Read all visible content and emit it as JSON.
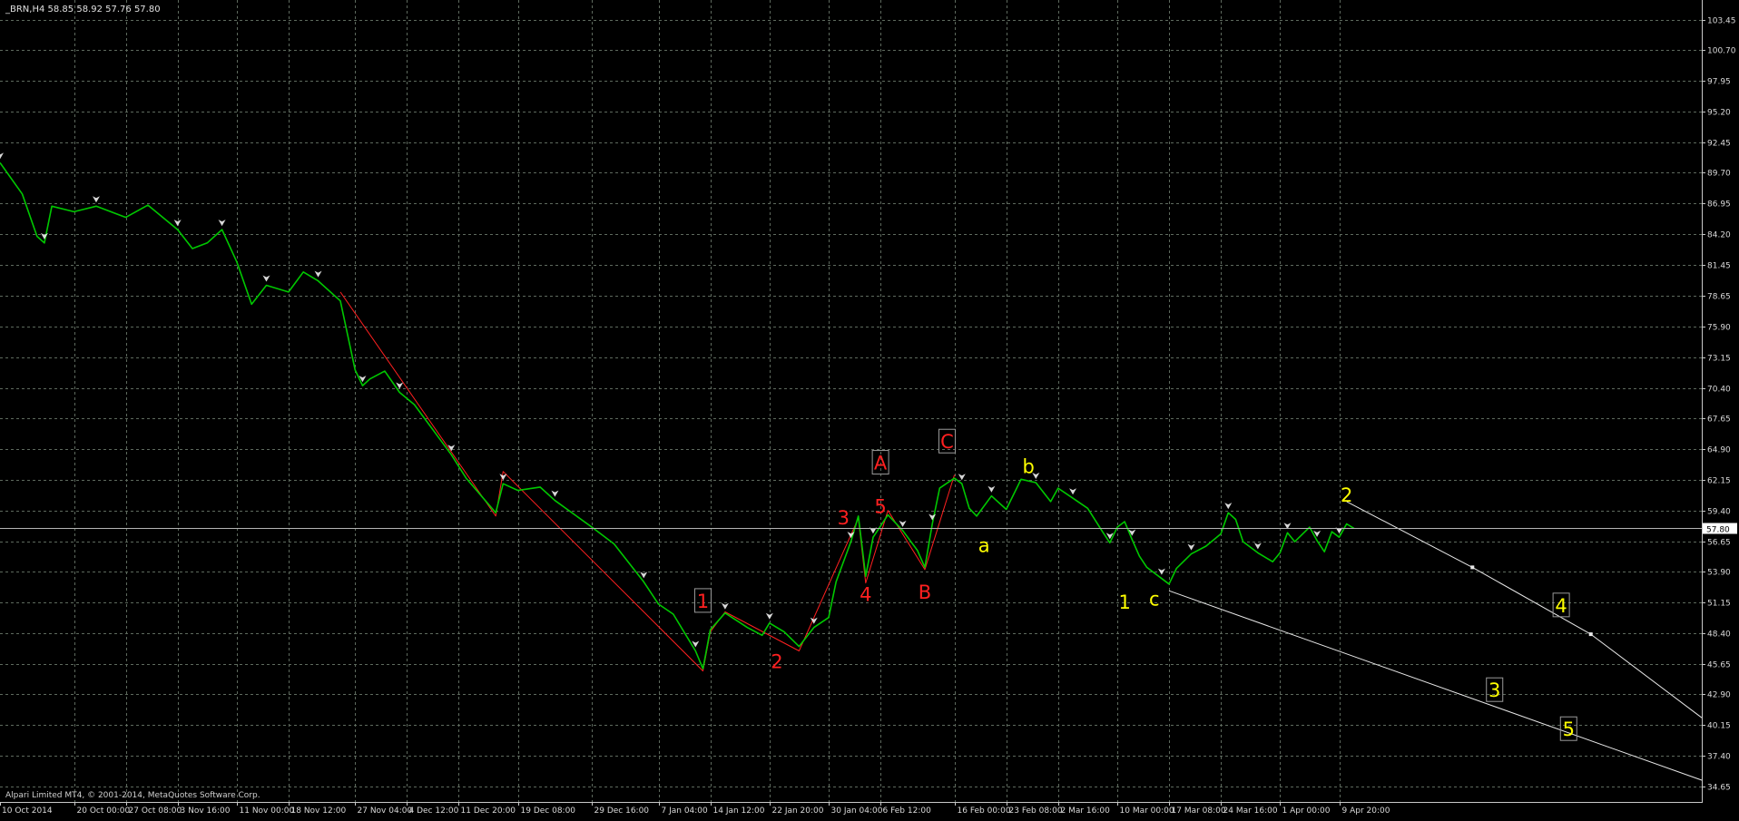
{
  "header": {
    "symbol_info": "_BRN,H4  58.85 58.92 57.76 57.80"
  },
  "footer": {
    "copyright": "Alpari Limited MT4, © 2001-2014, MetaQuotes Software Corp."
  },
  "current_price": {
    "label": "57.80",
    "value": 57.8
  },
  "colors": {
    "background": "#000000",
    "grid": "#5e6a5e",
    "price_line": "#00c800",
    "wave_red": "#ff2020",
    "wave_yellow": "#ffff00",
    "projection": "#e8e8e8",
    "axis_text": "#d8d8d8"
  },
  "chart_data": {
    "type": "line",
    "title": "",
    "symbol": "_BRN",
    "timeframe": "H4",
    "ohlc_header": {
      "open": 58.85,
      "high": 58.92,
      "low": 57.76,
      "close": 57.8
    },
    "ylim": [
      33.25,
      105.2
    ],
    "y_ticks": [
      103.45,
      100.7,
      97.95,
      95.2,
      92.45,
      89.7,
      86.95,
      84.2,
      81.45,
      78.65,
      75.9,
      73.15,
      70.4,
      67.65,
      64.9,
      62.15,
      59.4,
      56.65,
      53.9,
      51.15,
      48.4,
      45.65,
      42.9,
      40.15,
      37.4,
      34.65
    ],
    "y_tick_labels": [
      "103.45",
      "100.70",
      "97.95",
      "95.20",
      "92.45",
      "89.70",
      "86.95",
      "84.20",
      "81.45",
      "78.65",
      "75.90",
      "73.15",
      "70.40",
      "67.65",
      "64.90",
      "62.15",
      "59.40",
      "56.65",
      "53.90",
      "51.15",
      "48.40",
      "45.65",
      "42.90",
      "40.15",
      "37.40",
      "34.65"
    ],
    "x_range": [
      "2014-10-10",
      "2015-05-28"
    ],
    "x_ticks": [
      {
        "date": "2014-10-10",
        "label": "10 Oct 2014"
      },
      {
        "date": "2014-10-20",
        "label": "20 Oct 00:00"
      },
      {
        "date": "2014-10-27",
        "label": "27 Oct 08:00"
      },
      {
        "date": "2014-11-03",
        "label": "3 Nov 16:00"
      },
      {
        "date": "2014-11-11",
        "label": "11 Nov 00:00"
      },
      {
        "date": "2014-11-18",
        "label": "18 Nov 12:00"
      },
      {
        "date": "2014-11-27",
        "label": "27 Nov 04:00"
      },
      {
        "date": "2014-12-04",
        "label": "4 Dec 12:00"
      },
      {
        "date": "2014-12-11",
        "label": "11 Dec 20:00"
      },
      {
        "date": "2014-12-19",
        "label": "19 Dec 08:00"
      },
      {
        "date": "2014-12-29",
        "label": "29 Dec 16:00"
      },
      {
        "date": "2015-01-07",
        "label": "7 Jan 04:00"
      },
      {
        "date": "2015-01-14",
        "label": "14 Jan 12:00"
      },
      {
        "date": "2015-01-22",
        "label": "22 Jan 20:00"
      },
      {
        "date": "2015-01-30",
        "label": "30 Jan 04:00"
      },
      {
        "date": "2015-02-06",
        "label": "6 Feb 12:00"
      },
      {
        "date": "2015-02-16",
        "label": "16 Feb 00:00"
      },
      {
        "date": "2015-02-23",
        "label": "23 Feb 08:00"
      },
      {
        "date": "2015-03-02",
        "label": "2 Mar 16:00"
      },
      {
        "date": "2015-03-10",
        "label": "10 Mar 00:00"
      },
      {
        "date": "2015-03-17",
        "label": "17 Mar 08:00"
      },
      {
        "date": "2015-03-24",
        "label": "24 Mar 16:00"
      },
      {
        "date": "2015-04-01",
        "label": "1 Apr 00:00"
      },
      {
        "date": "2015-04-09",
        "label": "9 Apr 20:00"
      }
    ],
    "grid": true,
    "series": [
      {
        "role": "price",
        "values": [
          {
            "x": "2014-10-10",
            "y": 90.6
          },
          {
            "x": "2014-10-13",
            "y": 87.8
          },
          {
            "x": "2014-10-15",
            "y": 84.0
          },
          {
            "x": "2014-10-16",
            "y": 83.4
          },
          {
            "x": "2014-10-17",
            "y": 86.7
          },
          {
            "x": "2014-10-20",
            "y": 86.2
          },
          {
            "x": "2014-10-23",
            "y": 86.7
          },
          {
            "x": "2014-10-27",
            "y": 85.7
          },
          {
            "x": "2014-10-30",
            "y": 86.8
          },
          {
            "x": "2014-11-03",
            "y": 84.6
          },
          {
            "x": "2014-11-05",
            "y": 82.9
          },
          {
            "x": "2014-11-07",
            "y": 83.4
          },
          {
            "x": "2014-11-09",
            "y": 84.6
          },
          {
            "x": "2014-11-11",
            "y": 81.7
          },
          {
            "x": "2014-11-13",
            "y": 77.9
          },
          {
            "x": "2014-11-15",
            "y": 79.6
          },
          {
            "x": "2014-11-18",
            "y": 79.0
          },
          {
            "x": "2014-11-20",
            "y": 80.8
          },
          {
            "x": "2014-11-22",
            "y": 80.0
          },
          {
            "x": "2014-11-25",
            "y": 78.2
          },
          {
            "x": "2014-11-27",
            "y": 72.0
          },
          {
            "x": "2014-11-28",
            "y": 70.6
          },
          {
            "x": "2014-11-29",
            "y": 71.2
          },
          {
            "x": "2014-12-01",
            "y": 71.9
          },
          {
            "x": "2014-12-03",
            "y": 70.0
          },
          {
            "x": "2014-12-05",
            "y": 68.9
          },
          {
            "x": "2014-12-08",
            "y": 66.2
          },
          {
            "x": "2014-12-10",
            "y": 64.4
          },
          {
            "x": "2014-12-12",
            "y": 62.3
          },
          {
            "x": "2014-12-16",
            "y": 59.2
          },
          {
            "x": "2014-12-17",
            "y": 61.8
          },
          {
            "x": "2014-12-19",
            "y": 61.2
          },
          {
            "x": "2014-12-22",
            "y": 61.5
          },
          {
            "x": "2014-12-24",
            "y": 60.3
          },
          {
            "x": "2014-12-29",
            "y": 57.9
          },
          {
            "x": "2015-01-01",
            "y": 56.4
          },
          {
            "x": "2015-01-05",
            "y": 53.0
          },
          {
            "x": "2015-01-07",
            "y": 51.0
          },
          {
            "x": "2015-01-09",
            "y": 50.1
          },
          {
            "x": "2015-01-12",
            "y": 46.8
          },
          {
            "x": "2015-01-13",
            "y": 45.2
          },
          {
            "x": "2015-01-14",
            "y": 48.7
          },
          {
            "x": "2015-01-16",
            "y": 50.2
          },
          {
            "x": "2015-01-19",
            "y": 48.9
          },
          {
            "x": "2015-01-21",
            "y": 48.2
          },
          {
            "x": "2015-01-22",
            "y": 49.3
          },
          {
            "x": "2015-01-24",
            "y": 48.5
          },
          {
            "x": "2015-01-26",
            "y": 47.2
          },
          {
            "x": "2015-01-28",
            "y": 48.9
          },
          {
            "x": "2015-01-30",
            "y": 49.8
          },
          {
            "x": "2015-01-31",
            "y": 53.0
          },
          {
            "x": "2015-02-02",
            "y": 56.6
          },
          {
            "x": "2015-02-03",
            "y": 58.9
          },
          {
            "x": "2015-02-04",
            "y": 53.5
          },
          {
            "x": "2015-02-05",
            "y": 57.0
          },
          {
            "x": "2015-02-06",
            "y": 58.0
          },
          {
            "x": "2015-02-07",
            "y": 59.0
          },
          {
            "x": "2015-02-09",
            "y": 57.6
          },
          {
            "x": "2015-02-11",
            "y": 55.8
          },
          {
            "x": "2015-02-12",
            "y": 54.3
          },
          {
            "x": "2015-02-13",
            "y": 58.2
          },
          {
            "x": "2015-02-14",
            "y": 61.4
          },
          {
            "x": "2015-02-16",
            "y": 62.3
          },
          {
            "x": "2015-02-17",
            "y": 61.8
          },
          {
            "x": "2015-02-18",
            "y": 59.6
          },
          {
            "x": "2015-02-19",
            "y": 58.9
          },
          {
            "x": "2015-02-21",
            "y": 60.7
          },
          {
            "x": "2015-02-23",
            "y": 59.5
          },
          {
            "x": "2015-02-25",
            "y": 62.2
          },
          {
            "x": "2015-02-27",
            "y": 61.9
          },
          {
            "x": "2015-03-01",
            "y": 60.2
          },
          {
            "x": "2015-03-02",
            "y": 61.4
          },
          {
            "x": "2015-03-04",
            "y": 60.5
          },
          {
            "x": "2015-03-06",
            "y": 59.6
          },
          {
            "x": "2015-03-08",
            "y": 57.5
          },
          {
            "x": "2015-03-09",
            "y": 56.5
          },
          {
            "x": "2015-03-10",
            "y": 57.9
          },
          {
            "x": "2015-03-11",
            "y": 58.4
          },
          {
            "x": "2015-03-12",
            "y": 56.8
          },
          {
            "x": "2015-03-13",
            "y": 55.3
          },
          {
            "x": "2015-03-14",
            "y": 54.3
          },
          {
            "x": "2015-03-16",
            "y": 53.3
          },
          {
            "x": "2015-03-17",
            "y": 52.8
          },
          {
            "x": "2015-03-18",
            "y": 54.2
          },
          {
            "x": "2015-03-20",
            "y": 55.5
          },
          {
            "x": "2015-03-22",
            "y": 56.2
          },
          {
            "x": "2015-03-24",
            "y": 57.3
          },
          {
            "x": "2015-03-25",
            "y": 59.2
          },
          {
            "x": "2015-03-26",
            "y": 58.6
          },
          {
            "x": "2015-03-27",
            "y": 56.6
          },
          {
            "x": "2015-03-29",
            "y": 55.6
          },
          {
            "x": "2015-03-31",
            "y": 54.8
          },
          {
            "x": "2015-04-01",
            "y": 55.6
          },
          {
            "x": "2015-04-02",
            "y": 57.4
          },
          {
            "x": "2015-04-03",
            "y": 56.6
          },
          {
            "x": "2015-04-05",
            "y": 57.9
          },
          {
            "x": "2015-04-06",
            "y": 56.7
          },
          {
            "x": "2015-04-07",
            "y": 55.7
          },
          {
            "x": "2015-04-08",
            "y": 57.5
          },
          {
            "x": "2015-04-09",
            "y": 57.0
          },
          {
            "x": "2015-04-10",
            "y": 58.2
          },
          {
            "x": "2015-04-11",
            "y": 57.8
          }
        ]
      },
      {
        "role": "wave-count",
        "values": [
          {
            "x": "2014-11-25",
            "y": 79.0
          },
          {
            "x": "2014-12-16",
            "y": 58.9
          },
          {
            "x": "2014-12-17",
            "y": 62.9
          },
          {
            "x": "2015-01-13",
            "y": 45.0
          },
          {
            "x": "2015-01-14",
            "y": 48.5
          },
          {
            "x": "2015-01-16",
            "y": 50.3
          },
          {
            "x": "2015-01-26",
            "y": 46.8
          },
          {
            "x": "2015-02-03",
            "y": 58.7
          },
          {
            "x": "2015-02-04",
            "y": 52.9
          },
          {
            "x": "2015-02-07",
            "y": 59.4
          },
          {
            "x": "2015-02-12",
            "y": 54.1
          },
          {
            "x": "2015-02-16",
            "y": 62.6
          }
        ]
      },
      {
        "role": "projection-upper",
        "values": [
          {
            "x": "2015-04-10",
            "y": 60.2
          },
          {
            "x": "2015-04-27",
            "y": 54.3
          },
          {
            "x": "2015-05-13",
            "y": 48.3
          },
          {
            "x": "2015-05-28",
            "y": 40.8
          }
        ]
      },
      {
        "role": "projection-lower",
        "values": [
          {
            "x": "2015-03-17",
            "y": 52.2
          },
          {
            "x": "2015-05-28",
            "y": 35.2
          }
        ]
      }
    ],
    "annotations": [
      {
        "text": "1",
        "x": "2015-01-13",
        "y": 51.0,
        "color": "#ff2020",
        "boxed": true
      },
      {
        "text": "2",
        "x": "2015-01-23",
        "y": 45.6,
        "color": "#ff2020",
        "boxed": false
      },
      {
        "text": "3",
        "x": "2015-02-01",
        "y": 58.5,
        "color": "#ff2020",
        "boxed": false
      },
      {
        "text": "4",
        "x": "2015-02-04",
        "y": 51.6,
        "color": "#ff2020",
        "boxed": false
      },
      {
        "text": "5",
        "x": "2015-02-06",
        "y": 59.5,
        "color": "#ff2020",
        "boxed": false
      },
      {
        "text": "A",
        "x": "2015-02-06",
        "y": 63.4,
        "color": "#ff2020",
        "boxed": true
      },
      {
        "text": "B",
        "x": "2015-02-12",
        "y": 51.8,
        "color": "#ff2020",
        "boxed": false
      },
      {
        "text": "C",
        "x": "2015-02-15",
        "y": 65.3,
        "color": "#ff2020",
        "boxed": true
      },
      {
        "text": "a",
        "x": "2015-02-20",
        "y": 56.0,
        "color": "#ffff00",
        "boxed": false
      },
      {
        "text": "b",
        "x": "2015-02-26",
        "y": 63.1,
        "color": "#ffff00",
        "boxed": false
      },
      {
        "text": "1",
        "x": "2015-03-11",
        "y": 50.9,
        "color": "#ffff00",
        "boxed": false
      },
      {
        "text": "c",
        "x": "2015-03-15",
        "y": 51.2,
        "color": "#ffff00",
        "boxed": false
      },
      {
        "text": "2",
        "x": "2015-04-10",
        "y": 60.5,
        "color": "#ffff00",
        "boxed": false
      },
      {
        "text": "3",
        "x": "2015-04-30",
        "y": 43.0,
        "color": "#ffff00",
        "boxed": true
      },
      {
        "text": "4",
        "x": "2015-05-09",
        "y": 50.6,
        "color": "#ffff00",
        "boxed": true
      },
      {
        "text": "5",
        "x": "2015-05-10",
        "y": 39.5,
        "color": "#ffff00",
        "boxed": true
      }
    ]
  }
}
